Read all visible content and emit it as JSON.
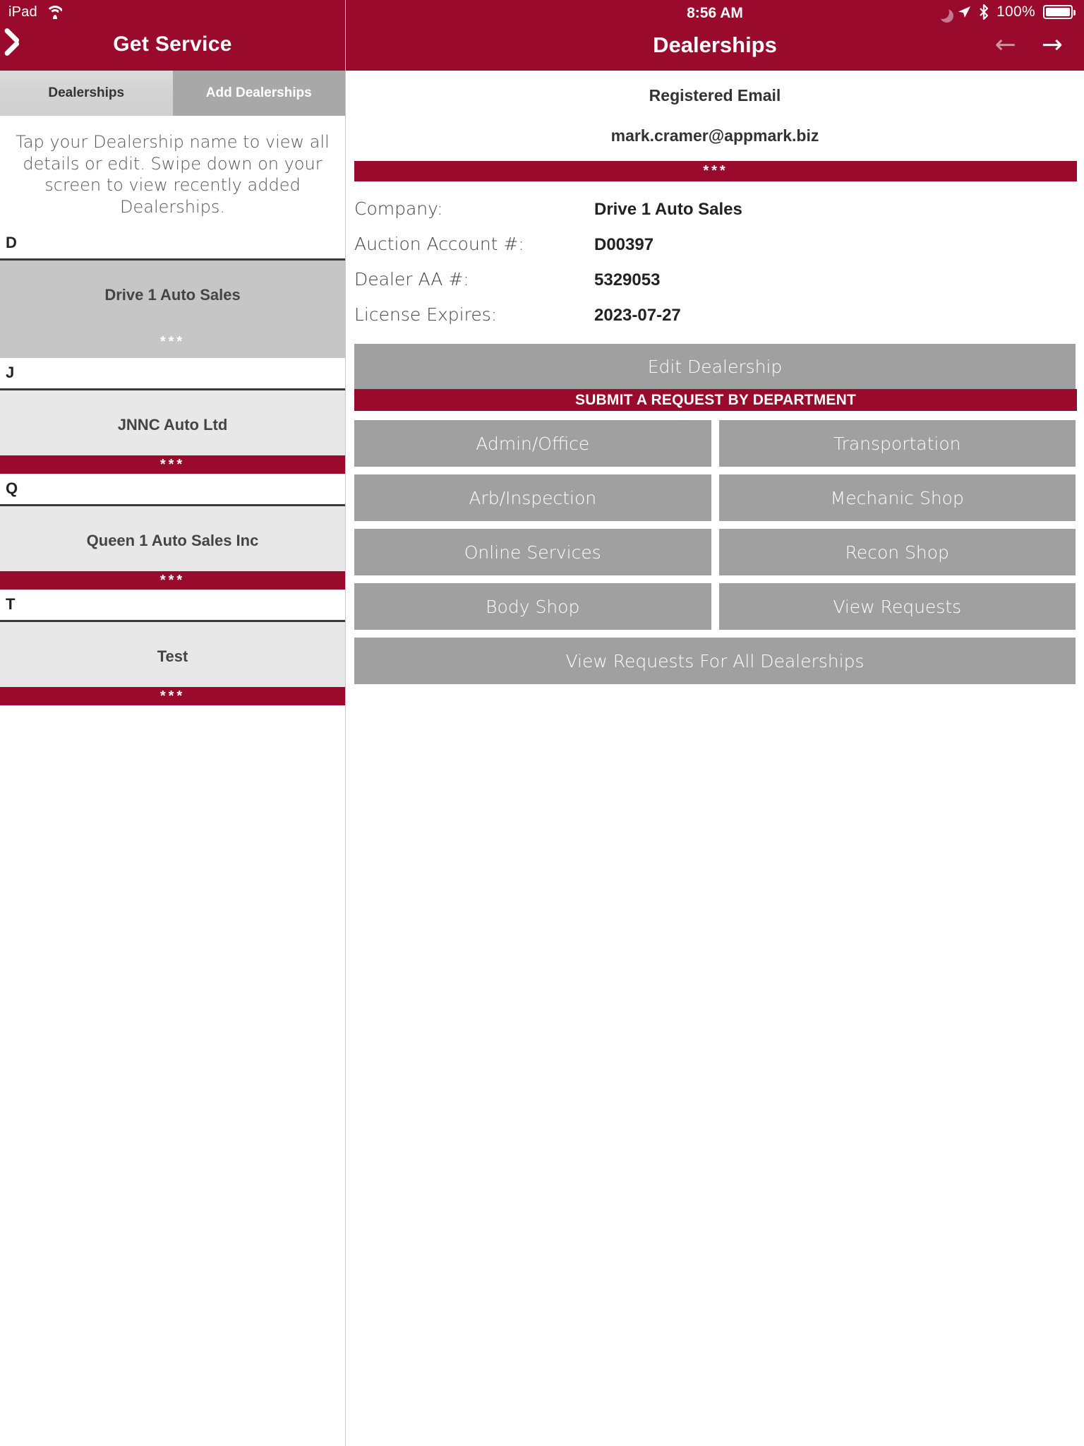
{
  "status_bar": {
    "device_label": "iPad",
    "wifi_icon": "wifi-icon",
    "time": "8:56 AM",
    "moon_icon": "moon-icon",
    "location_icon": "location-arrow-icon",
    "bluetooth_icon": "bluetooth-icon",
    "battery_percent": "100%",
    "battery_icon": "battery-full-icon"
  },
  "colors": {
    "brand_red": "#9a0a2d",
    "button_gray": "#a0a0a0",
    "row_selected_gray": "#c6c6c6",
    "row_unselected_gray": "#e8e8e8",
    "tab_unselected_gray": "#a8a8a8"
  },
  "left_pane": {
    "back_icon": "back-chevron-icon",
    "title": "Get Service",
    "tabs": [
      {
        "label": "Dealerships",
        "selected": true
      },
      {
        "label": "Add Dealerships",
        "selected": false
      }
    ],
    "instructions": "Tap your Dealership name to view all details or edit. Swipe down on your screen to view recently added Dealerships.",
    "separator_text": "***",
    "sections": [
      {
        "letter": "D",
        "dealership": "Drive 1 Auto Sales",
        "selected": true
      },
      {
        "letter": "J",
        "dealership": "JNNC Auto Ltd",
        "selected": false
      },
      {
        "letter": "Q",
        "dealership": "Queen 1 Auto Sales Inc",
        "selected": false
      },
      {
        "letter": "T",
        "dealership": "Test",
        "selected": false
      }
    ]
  },
  "right_pane": {
    "title": "Dealerships",
    "prev_arrow": "arrow-left-icon",
    "next_arrow": "arrow-right-icon",
    "registered_email_label": "Registered Email",
    "registered_email_value": "mark.cramer@appmark.biz",
    "separator_text": "***",
    "details": [
      {
        "label": "Company:",
        "value": "Drive 1 Auto Sales"
      },
      {
        "label": "Auction Account #:",
        "value": "D00397"
      },
      {
        "label": "Dealer AA #:",
        "value": "5329053"
      },
      {
        "label": "License Expires:",
        "value": "2023-07-27"
      }
    ],
    "edit_button": "Edit Dealership",
    "department_header": "SUBMIT A REQUEST BY DEPARTMENT",
    "departments": [
      "Admin/Office",
      "Transportation",
      "Arb/Inspection",
      "Mechanic Shop",
      "Online Services",
      "Recon Shop",
      "Body Shop",
      "View Requests"
    ],
    "view_all_button": "View Requests For All Dealerships"
  }
}
